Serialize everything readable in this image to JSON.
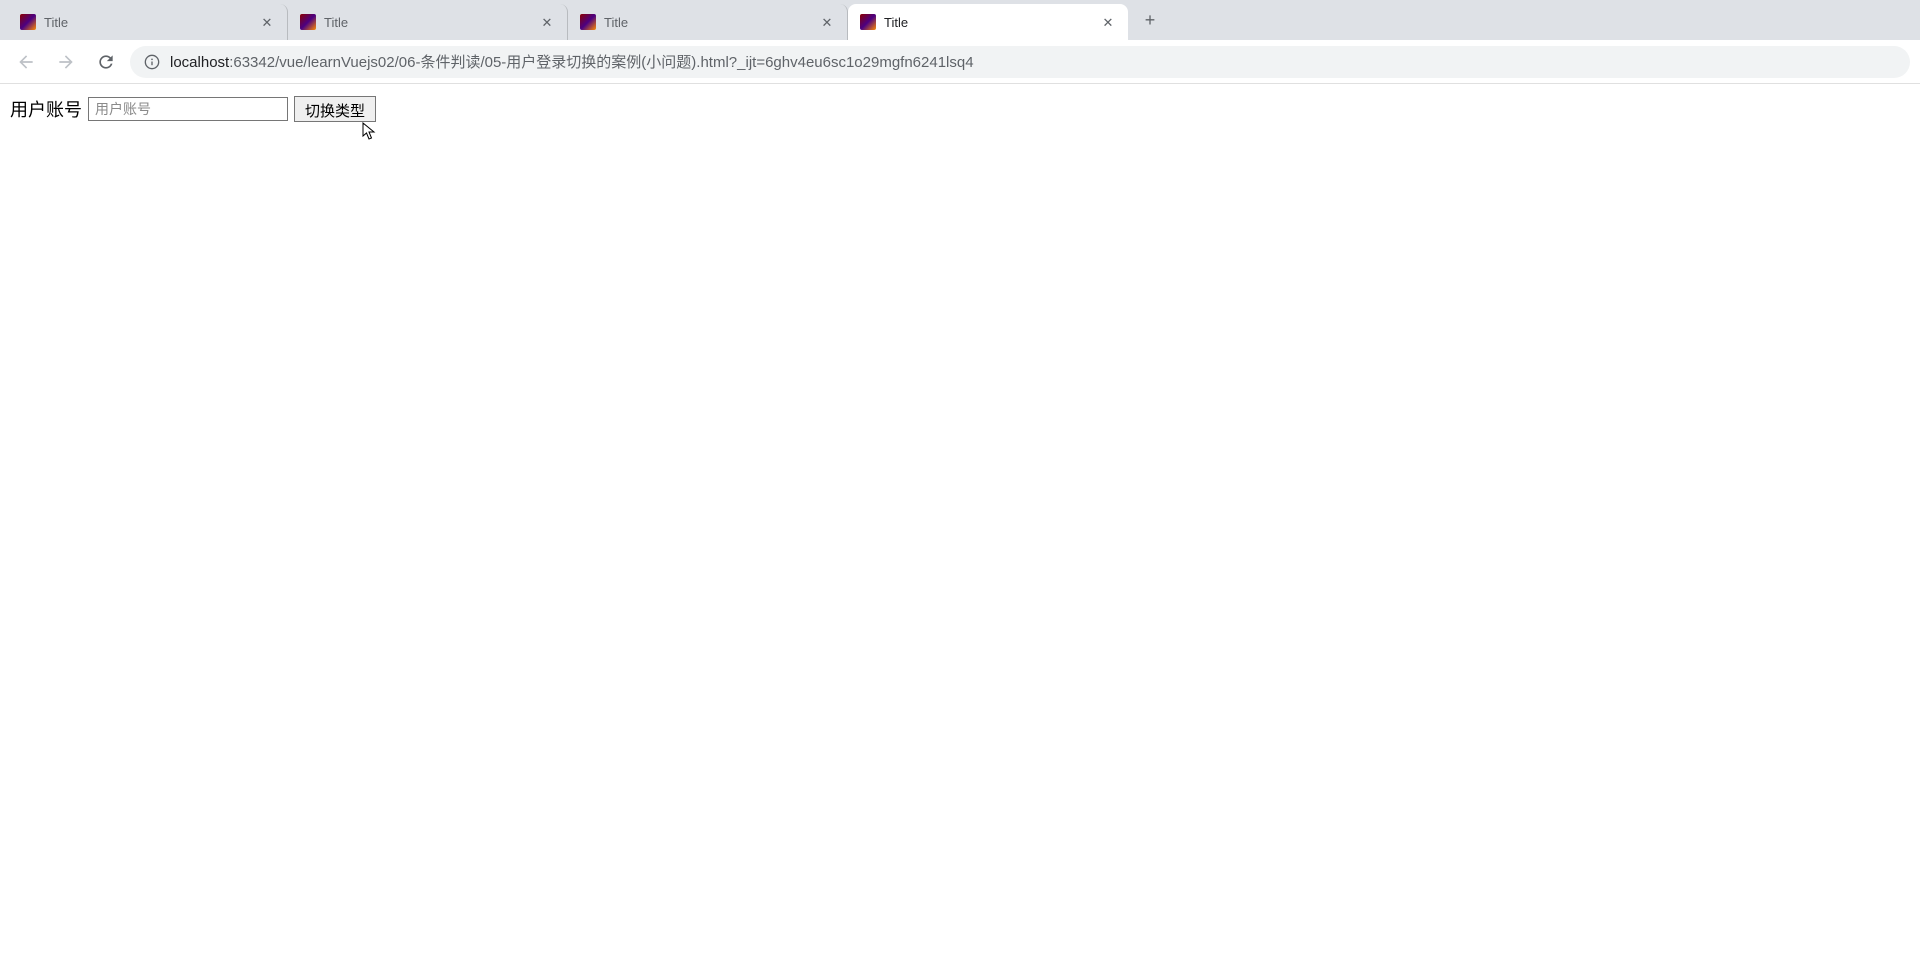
{
  "tabs": [
    {
      "title": "Title",
      "active": false
    },
    {
      "title": "Title",
      "active": false
    },
    {
      "title": "Title",
      "active": false
    },
    {
      "title": "Title",
      "active": true
    }
  ],
  "url": {
    "host": "localhost",
    "port_path": ":63342/vue/learnVuejs02/06-条件判读/05-用户登录切换的案例(小问题).html?_ijt=6ghv4eu6sc1o29mgfn6241lsq4"
  },
  "page": {
    "label": "用户账号",
    "input_placeholder": "用户账号",
    "input_value": "",
    "button_label": "切换类型"
  }
}
